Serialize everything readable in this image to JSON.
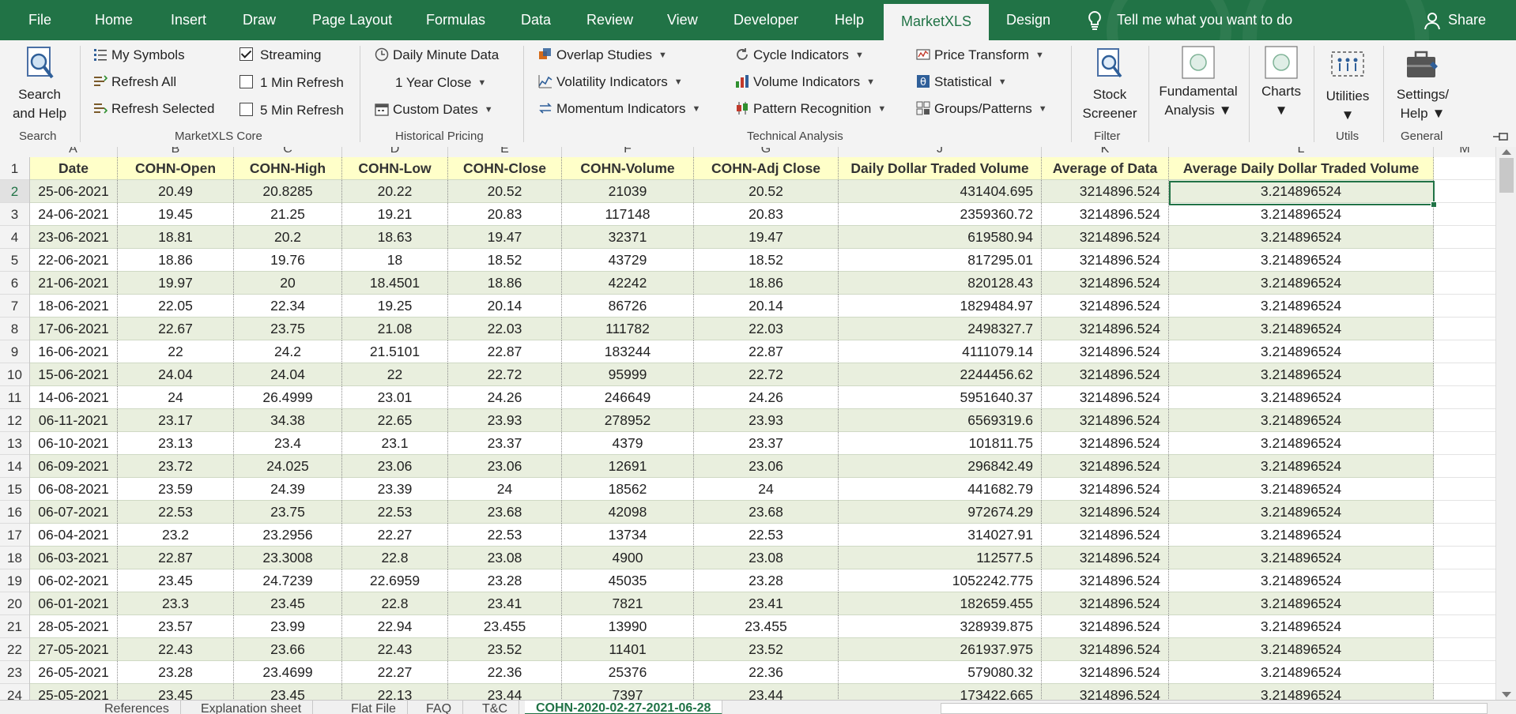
{
  "menubar": {
    "tabs": [
      "File",
      "Home",
      "Insert",
      "Draw",
      "Page Layout",
      "Formulas",
      "Data",
      "Review",
      "View",
      "Developer",
      "Help",
      "MarketXLS",
      "Design"
    ],
    "active_tab": "MarketXLS",
    "tell_me": "Tell me what you want to do",
    "share": "Share"
  },
  "ribbon": {
    "search": {
      "label_line1": "Search",
      "label_line2": "and Help",
      "group": "Search"
    },
    "core": {
      "items": [
        "My Symbols",
        "Refresh All",
        "Refresh Selected"
      ],
      "streaming": "Streaming",
      "min1": "1 Min Refresh",
      "min5": "5 Min Refresh",
      "streaming_checked": true,
      "group": "MarketXLS Core"
    },
    "pricing": {
      "daily_minute": "Daily Minute Data",
      "year_close": "1 Year Close",
      "custom_dates": "Custom Dates",
      "group": "Historical Pricing"
    },
    "technical": {
      "col1": [
        "Overlap Studies",
        "Volatility Indicators",
        "Momentum Indicators"
      ],
      "col2": [
        "Cycle Indicators",
        "Volume Indicators",
        "Pattern Recognition"
      ],
      "col3": [
        "Price Transform",
        "Statistical",
        "Groups/Patterns"
      ],
      "group": "Technical Analysis"
    },
    "filter": {
      "line1": "Stock",
      "line2": "Screener",
      "group": "Filter"
    },
    "fundamental": {
      "line1": "Fundamental",
      "line2": "Analysis"
    },
    "charts": "Charts",
    "utils": {
      "label": "Utilities",
      "group": "Utils"
    },
    "settings": {
      "line1": "Settings/",
      "line2": "Help",
      "group": "General"
    }
  },
  "grid": {
    "col_letters": [
      "A",
      "B",
      "C",
      "D",
      "E",
      "F",
      "G",
      "J",
      "K",
      "L",
      "M"
    ],
    "headers": [
      "Date",
      "COHN-Open",
      "COHN-High",
      "COHN-Low",
      "COHN-Close",
      "COHN-Volume",
      "COHN-Adj Close",
      "Daily Dollar Traded Volume",
      "Average of Data",
      "Average Daily Dollar Traded Volume"
    ],
    "row_numbers": [
      "1",
      "2",
      "3",
      "4",
      "5",
      "6",
      "7",
      "8",
      "9",
      "10",
      "11",
      "12",
      "13",
      "14",
      "15",
      "16",
      "17",
      "18",
      "19",
      "20",
      "21",
      "22",
      "23",
      "24"
    ],
    "rows": [
      [
        "25-06-2021",
        "20.49",
        "20.8285",
        "20.22",
        "20.52",
        "21039",
        "20.52",
        "431404.695",
        "3214896.524",
        "3.214896524"
      ],
      [
        "24-06-2021",
        "19.45",
        "21.25",
        "19.21",
        "20.83",
        "117148",
        "20.83",
        "2359360.72",
        "3214896.524",
        "3.214896524"
      ],
      [
        "23-06-2021",
        "18.81",
        "20.2",
        "18.63",
        "19.47",
        "32371",
        "19.47",
        "619580.94",
        "3214896.524",
        "3.214896524"
      ],
      [
        "22-06-2021",
        "18.86",
        "19.76",
        "18",
        "18.52",
        "43729",
        "18.52",
        "817295.01",
        "3214896.524",
        "3.214896524"
      ],
      [
        "21-06-2021",
        "19.97",
        "20",
        "18.4501",
        "18.86",
        "42242",
        "18.86",
        "820128.43",
        "3214896.524",
        "3.214896524"
      ],
      [
        "18-06-2021",
        "22.05",
        "22.34",
        "19.25",
        "20.14",
        "86726",
        "20.14",
        "1829484.97",
        "3214896.524",
        "3.214896524"
      ],
      [
        "17-06-2021",
        "22.67",
        "23.75",
        "21.08",
        "22.03",
        "111782",
        "22.03",
        "2498327.7",
        "3214896.524",
        "3.214896524"
      ],
      [
        "16-06-2021",
        "22",
        "24.2",
        "21.5101",
        "22.87",
        "183244",
        "22.87",
        "4111079.14",
        "3214896.524",
        "3.214896524"
      ],
      [
        "15-06-2021",
        "24.04",
        "24.04",
        "22",
        "22.72",
        "95999",
        "22.72",
        "2244456.62",
        "3214896.524",
        "3.214896524"
      ],
      [
        "14-06-2021",
        "24",
        "26.4999",
        "23.01",
        "24.26",
        "246649",
        "24.26",
        "5951640.37",
        "3214896.524",
        "3.214896524"
      ],
      [
        "06-11-2021",
        "23.17",
        "34.38",
        "22.65",
        "23.93",
        "278952",
        "23.93",
        "6569319.6",
        "3214896.524",
        "3.214896524"
      ],
      [
        "06-10-2021",
        "23.13",
        "23.4",
        "23.1",
        "23.37",
        "4379",
        "23.37",
        "101811.75",
        "3214896.524",
        "3.214896524"
      ],
      [
        "06-09-2021",
        "23.72",
        "24.025",
        "23.06",
        "23.06",
        "12691",
        "23.06",
        "296842.49",
        "3214896.524",
        "3.214896524"
      ],
      [
        "06-08-2021",
        "23.59",
        "24.39",
        "23.39",
        "24",
        "18562",
        "24",
        "441682.79",
        "3214896.524",
        "3.214896524"
      ],
      [
        "06-07-2021",
        "22.53",
        "23.75",
        "22.53",
        "23.68",
        "42098",
        "23.68",
        "972674.29",
        "3214896.524",
        "3.214896524"
      ],
      [
        "06-04-2021",
        "23.2",
        "23.2956",
        "22.27",
        "22.53",
        "13734",
        "22.53",
        "314027.91",
        "3214896.524",
        "3.214896524"
      ],
      [
        "06-03-2021",
        "22.87",
        "23.3008",
        "22.8",
        "23.08",
        "4900",
        "23.08",
        "112577.5",
        "3214896.524",
        "3.214896524"
      ],
      [
        "06-02-2021",
        "23.45",
        "24.7239",
        "22.6959",
        "23.28",
        "45035",
        "23.28",
        "1052242.775",
        "3214896.524",
        "3.214896524"
      ],
      [
        "06-01-2021",
        "23.3",
        "23.45",
        "22.8",
        "23.41",
        "7821",
        "23.41",
        "182659.455",
        "3214896.524",
        "3.214896524"
      ],
      [
        "28-05-2021",
        "23.57",
        "23.99",
        "22.94",
        "23.455",
        "13990",
        "23.455",
        "328939.875",
        "3214896.524",
        "3.214896524"
      ],
      [
        "27-05-2021",
        "22.43",
        "23.66",
        "22.43",
        "23.52",
        "11401",
        "23.52",
        "261937.975",
        "3214896.524",
        "3.214896524"
      ],
      [
        "26-05-2021",
        "23.28",
        "23.4699",
        "22.27",
        "22.36",
        "25376",
        "22.36",
        "579080.32",
        "3214896.524",
        "3.214896524"
      ],
      [
        "25-05-2021",
        "23.45",
        "23.45",
        "22.13",
        "23.44",
        "7397",
        "23.44",
        "173422.665",
        "3214896.524",
        "3.214896524"
      ]
    ]
  },
  "sheet_tabs": [
    "References",
    "Explanation sheet",
    "Flat File",
    "FAQ",
    "T&C",
    "COHN-2020-02-27-2021-06-28"
  ],
  "active_sheet": "COHN-2020-02-27-2021-06-28"
}
